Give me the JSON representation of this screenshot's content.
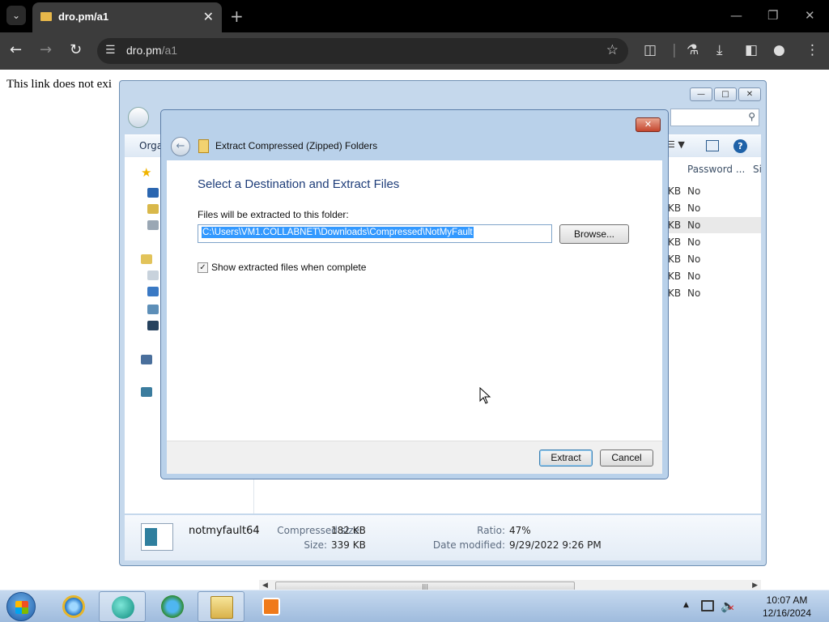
{
  "browser": {
    "tab_title": "dro.pm/a1",
    "url_host": "dro.pm",
    "url_path": "/a1",
    "icons": [
      "tab-search-icon",
      "close-icon",
      "new-tab-icon",
      "back-icon",
      "forward-icon",
      "reload-icon",
      "site-info-icon",
      "bookmark-star-icon",
      "extensions-icon",
      "labs-icon",
      "download-icon",
      "side-panel-icon",
      "profile-icon",
      "menu-icon"
    ]
  },
  "page": {
    "text": "This link does not exi"
  },
  "explorer": {
    "organize_label": "Orga",
    "columns": [
      "Password ...",
      "Si"
    ],
    "rows": [
      {
        "size": "KB",
        "password": "No"
      },
      {
        "size": "KB",
        "password": "No"
      },
      {
        "size": "KB",
        "password": "No"
      },
      {
        "size": "KB",
        "password": "No"
      },
      {
        "size": "KB",
        "password": "No"
      },
      {
        "size": "KB",
        "password": "No"
      },
      {
        "size": "KB",
        "password": "No"
      }
    ],
    "details": {
      "file_name": "notmyfault64",
      "compressed_size_label": "Compressed size:",
      "compressed_size": "182 KB",
      "size_label": "Size:",
      "size": "339 KB",
      "ratio_label": "Ratio:",
      "ratio": "47%",
      "date_label": "Date modified:",
      "date": "9/29/2022 9:26 PM"
    }
  },
  "dialog": {
    "title": "Extract Compressed (Zipped) Folders",
    "heading": "Select a Destination and Extract Files",
    "destination_label": "Files will be extracted to this folder:",
    "destination_value": "C:\\Users\\VM1.COLLABNET\\Downloads\\Compressed\\NotMyFault",
    "browse_label": "Browse...",
    "show_files_label": "Show extracted files when complete",
    "show_files_checked": true,
    "extract_label": "Extract",
    "cancel_label": "Cancel"
  },
  "taskbar": {
    "time": "10:07 AM",
    "date": "12/16/2024",
    "apps": [
      "internet-explorer-icon",
      "chat-app-icon",
      "download-manager-icon",
      "file-explorer-icon",
      "media-player-icon"
    ]
  },
  "colors": {
    "browser_bg": "#3c3c3c",
    "selection": "#3399ff",
    "dialog_heading": "#1e3d79"
  }
}
